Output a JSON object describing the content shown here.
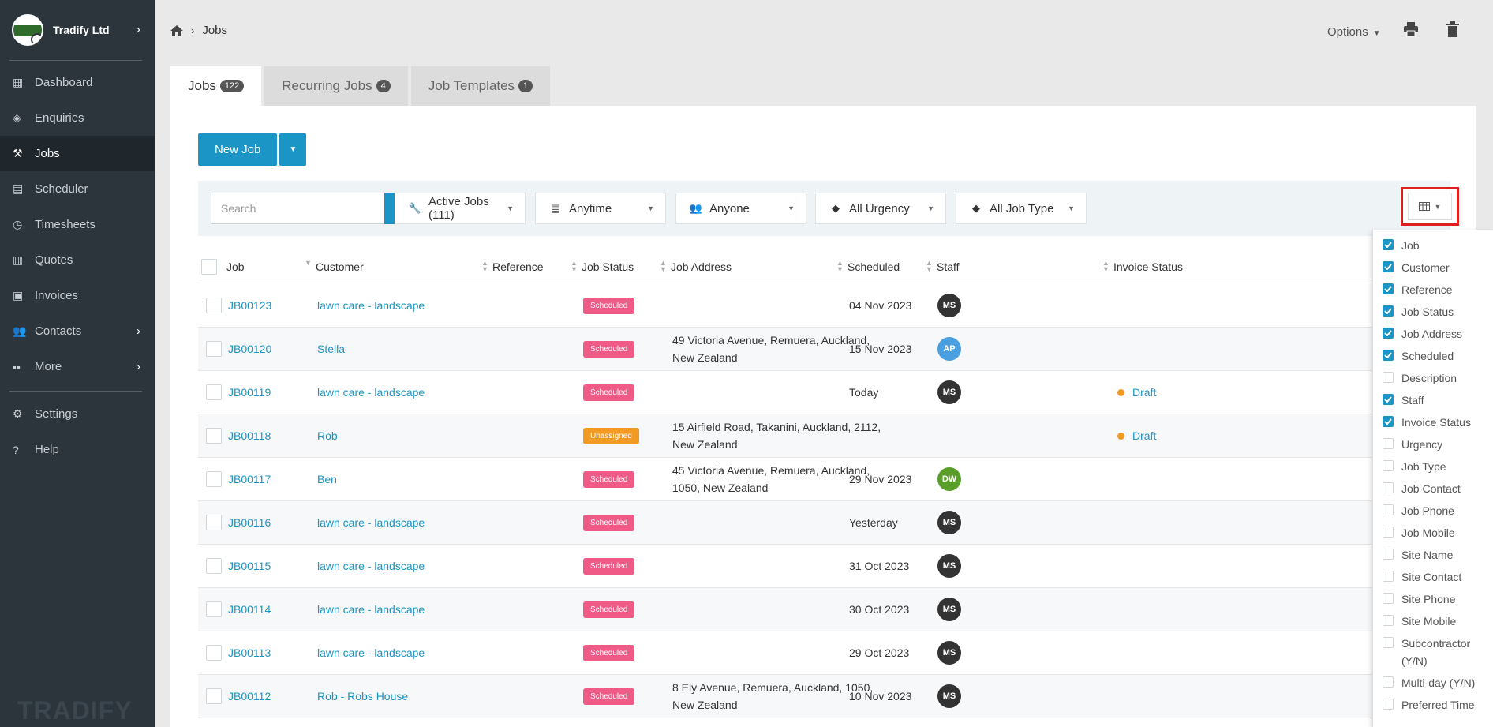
{
  "brand": {
    "name": "Tradify Ltd",
    "footer_logo": "TRADIFY"
  },
  "sidebar": {
    "items": [
      {
        "label": "Dashboard",
        "icon": "dashboard-icon"
      },
      {
        "label": "Enquiries",
        "icon": "tags-icon"
      },
      {
        "label": "Jobs",
        "icon": "hammer-icon",
        "active": true
      },
      {
        "label": "Scheduler",
        "icon": "calendar-icon"
      },
      {
        "label": "Timesheets",
        "icon": "clock-icon"
      },
      {
        "label": "Quotes",
        "icon": "calculator-icon"
      },
      {
        "label": "Invoices",
        "icon": "invoice-icon"
      },
      {
        "label": "Contacts",
        "icon": "users-icon",
        "arrow": true
      },
      {
        "label": "More",
        "icon": "grid-icon",
        "arrow": true
      },
      {
        "label": "Settings",
        "icon": "gear-icon"
      },
      {
        "label": "Help",
        "icon": "help-icon"
      }
    ]
  },
  "header": {
    "breadcrumb": "Jobs",
    "options_label": "Options"
  },
  "tabs": [
    {
      "label": "Jobs",
      "count": "122"
    },
    {
      "label": "Recurring Jobs",
      "count": "4"
    },
    {
      "label": "Job Templates",
      "count": "1"
    }
  ],
  "toolbar": {
    "new_job_label": "New Job"
  },
  "filters": {
    "search_placeholder": "Search",
    "status": "Active Jobs (111)",
    "date": "Anytime",
    "staff": "Anyone",
    "urgency": "All Urgency",
    "job_type": "All Job Type"
  },
  "table": {
    "columns": [
      "Job",
      "Customer",
      "Reference",
      "Job Status",
      "Job Address",
      "Scheduled",
      "Staff",
      "Invoice Status"
    ],
    "rows": [
      {
        "job": "JB00123",
        "customer": "lawn care - landscape",
        "status": "Scheduled",
        "address1": "",
        "address2": "",
        "scheduled": "04 Nov 2023",
        "staff": "MS",
        "invoice": ""
      },
      {
        "job": "JB00120",
        "customer": "Stella",
        "status": "Scheduled",
        "address1": "49 Victoria Avenue, Remuera, Auckland,",
        "address2": "New Zealand",
        "scheduled": "15 Nov 2023",
        "staff": "AP",
        "invoice": ""
      },
      {
        "job": "JB00119",
        "customer": "lawn care - landscape",
        "status": "Scheduled",
        "address1": "",
        "address2": "",
        "scheduled": "Today",
        "staff": "MS",
        "invoice": "Draft"
      },
      {
        "job": "JB00118",
        "customer": "Rob",
        "status": "Unassigned",
        "address1": "15 Airfield Road, Takanini, Auckland, 2112,",
        "address2": "New Zealand",
        "scheduled": "",
        "staff": "",
        "invoice": "Draft"
      },
      {
        "job": "JB00117",
        "customer": "Ben",
        "status": "Scheduled",
        "address1": "45 Victoria Avenue, Remuera, Auckland,",
        "address2": "1050, New Zealand",
        "scheduled": "29 Nov 2023",
        "staff": "DW",
        "invoice": ""
      },
      {
        "job": "JB00116",
        "customer": "lawn care - landscape",
        "status": "Scheduled",
        "address1": "",
        "address2": "",
        "scheduled": "Yesterday",
        "staff": "MS",
        "invoice": ""
      },
      {
        "job": "JB00115",
        "customer": "lawn care - landscape",
        "status": "Scheduled",
        "address1": "",
        "address2": "",
        "scheduled": "31 Oct 2023",
        "staff": "MS",
        "invoice": ""
      },
      {
        "job": "JB00114",
        "customer": "lawn care - landscape",
        "status": "Scheduled",
        "address1": "",
        "address2": "",
        "scheduled": "30 Oct 2023",
        "staff": "MS",
        "invoice": ""
      },
      {
        "job": "JB00113",
        "customer": "lawn care - landscape",
        "status": "Scheduled",
        "address1": "",
        "address2": "",
        "scheduled": "29 Oct 2023",
        "staff": "MS",
        "invoice": ""
      },
      {
        "job": "JB00112",
        "customer": "Rob - Robs House",
        "status": "Scheduled",
        "address1": "8 Ely Avenue, Remuera, Auckland, 1050,",
        "address2": "New Zealand",
        "scheduled": "10 Nov 2023",
        "staff": "MS",
        "invoice": ""
      }
    ]
  },
  "column_menu": [
    {
      "label": "Job",
      "checked": true
    },
    {
      "label": "Customer",
      "checked": true
    },
    {
      "label": "Reference",
      "checked": true
    },
    {
      "label": "Job Status",
      "checked": true
    },
    {
      "label": "Job Address",
      "checked": true
    },
    {
      "label": "Scheduled",
      "checked": true
    },
    {
      "label": "Description",
      "checked": false
    },
    {
      "label": "Staff",
      "checked": true
    },
    {
      "label": "Invoice Status",
      "checked": true
    },
    {
      "label": "Urgency",
      "checked": false
    },
    {
      "label": "Job Type",
      "checked": false
    },
    {
      "label": "Job Contact",
      "checked": false
    },
    {
      "label": "Job Phone",
      "checked": false
    },
    {
      "label": "Job Mobile",
      "checked": false
    },
    {
      "label": "Site Name",
      "checked": false
    },
    {
      "label": "Site Contact",
      "checked": false
    },
    {
      "label": "Site Phone",
      "checked": false
    },
    {
      "label": "Site Mobile",
      "checked": false
    },
    {
      "label": "Subcontractor (Y/N)",
      "checked": false
    },
    {
      "label": "Multi-day (Y/N)",
      "checked": false
    },
    {
      "label": "Preferred Time",
      "checked": false
    }
  ],
  "colors": {
    "accent": "#1b95c5",
    "sidebar_bg": "#2c353c",
    "scheduled": "#f05a87",
    "unassigned": "#f39a22",
    "avatar_MS": "#333333",
    "avatar_AP": "#4a9fe0",
    "avatar_DW": "#5a9e2a",
    "highlight": "#e02020"
  }
}
